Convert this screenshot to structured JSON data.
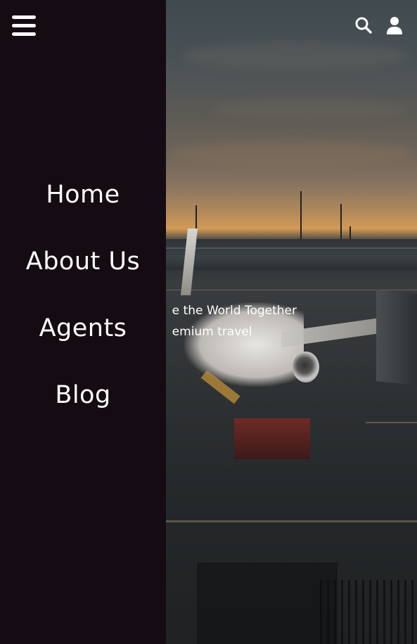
{
  "header": {
    "menu_icon": "hamburger-menu-icon",
    "search_icon": "search-icon",
    "account_icon": "user-icon"
  },
  "drawer": {
    "items": [
      {
        "label": "Home"
      },
      {
        "label": "About Us"
      },
      {
        "label": "Agents"
      },
      {
        "label": "Blog"
      }
    ]
  },
  "hero": {
    "line1": "e the World Together",
    "line2": "emium travel"
  },
  "colors": {
    "drawer_bg": "#150b13",
    "text": "#ffffff"
  }
}
